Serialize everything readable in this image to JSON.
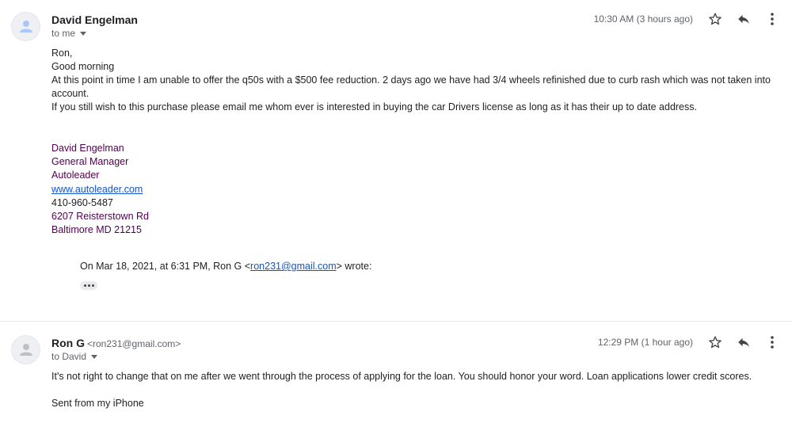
{
  "messages": [
    {
      "sender": "David Engelman",
      "recipient": "to me",
      "time": "10:30 AM (3 hours ago)",
      "body": [
        "Ron,",
        "Good morning",
        "At this point in time I am unable to offer the q50s with a $500 fee reduction.  2 days ago we have had 3/4 wheels refinished due to curb rash which was not taken into account.",
        "If you still wish to this purchase please email me whom ever is interested in buying the car Drivers license as long as it has their up to date address."
      ],
      "signature": {
        "name": "David Engelman",
        "title": "General Manager",
        "company": "Autoleader",
        "website": "www.autoleader.com",
        "phone": "410-960-5487",
        "street": "6207 Reisterstown Rd",
        "city": "Baltimore MD 21215"
      },
      "quote": {
        "prefix": "On Mar 18, 2021, at 6:31 PM, Ron G <",
        "email": "ron231@gmail.com",
        "suffix": "> wrote:"
      }
    },
    {
      "sender": "Ron G",
      "email": "<ron231@gmail.com>",
      "recipient": "to David",
      "time": "12:29 PM (1 hour ago)",
      "body": [
        "It's not right to change that on me after we went through the process of applying for the loan. You should honor your word. Loan applications lower credit scores.",
        "Sent from my iPhone"
      ]
    }
  ]
}
